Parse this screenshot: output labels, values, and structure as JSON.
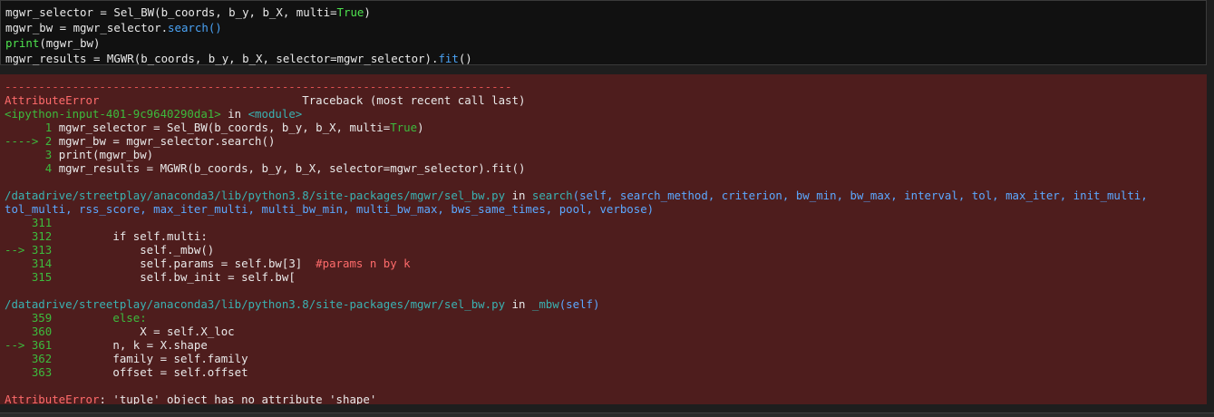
{
  "input_cell": {
    "lines": [
      [
        "mgwr_selector = Sel_BW(b_coords, b_y, b_X, multi=",
        "True",
        ")"
      ],
      [
        "mgwr_bw = mgwr_selector.",
        "search",
        "()"
      ],
      [
        "print",
        "(mgwr_bw)"
      ],
      [
        "mgwr_results = MGWR(b_coords, b_y, b_X, selector=mgwr_selector).",
        "fit",
        "()"
      ]
    ]
  },
  "traceback": {
    "separator": "---------------------------------------------------------------------------",
    "error_type": "AttributeError",
    "header_gap": "                              ",
    "header_right": "Traceback (most recent call last)",
    "ipython_input": "<ipython-input-401-9c9640290da1>",
    "in_text": " in ",
    "module": "<module>",
    "frame1": [
      {
        "marker": "      1 ",
        "code_a": "mgwr_selector = Sel_BW(b_coords, b_y, b_X, multi=",
        "code_b": "True",
        "code_c": ")"
      },
      {
        "marker": "----> 2 ",
        "code_a": "mgwr_bw = mgwr_selector.search()",
        "code_b": "",
        "code_c": ""
      },
      {
        "marker": "      3 ",
        "code_a": "print(mgwr_bw)",
        "code_b": "",
        "code_c": ""
      },
      {
        "marker": "      4 ",
        "code_a": "mgwr_results = MGWR(b_coords, b_y, b_X, selector=mgwr_selector).fit()",
        "code_b": "",
        "code_c": ""
      }
    ],
    "file_path": "/datadrive/streetplay/anaconda3/lib/python3.8/site-packages/mgwr/sel_bw.py",
    "frame2_func": "search",
    "frame2_args_1": "(self, search_method, criterion, bw_min, bw_max, interval, tol, max_iter, init_multi,",
    "frame2_args_2": "tol_multi, rss_score, max_iter_multi, multi_bw_min, multi_bw_max, bws_same_times, pool, verbose)",
    "frame2_lines": [
      {
        "marker": "    311 ",
        "code": ""
      },
      {
        "marker": "    312 ",
        "code": "        if self.multi:"
      },
      {
        "marker": "--> 313 ",
        "code": "            self._mbw()"
      },
      {
        "marker": "    314 ",
        "code": "            self.params = self.bw[3]  ",
        "comment": "#params n by k"
      },
      {
        "marker": "    315 ",
        "code": "            self.bw_init = self.bw["
      }
    ],
    "frame3_func": "_mbw",
    "frame3_args": "(self)",
    "frame3_lines": [
      {
        "marker": "    359 ",
        "code": "        else:"
      },
      {
        "marker": "    360 ",
        "code": "            X = self.X_loc"
      },
      {
        "marker": "--> 361 ",
        "code": "        n, k = X.shape"
      },
      {
        "marker": "    362 ",
        "code": "        family = self.family"
      },
      {
        "marker": "    363 ",
        "code": "        offset = self.offset"
      }
    ],
    "final_error_type": "AttributeError",
    "final_message": ": 'tuple' object has no attribute 'shape'"
  }
}
